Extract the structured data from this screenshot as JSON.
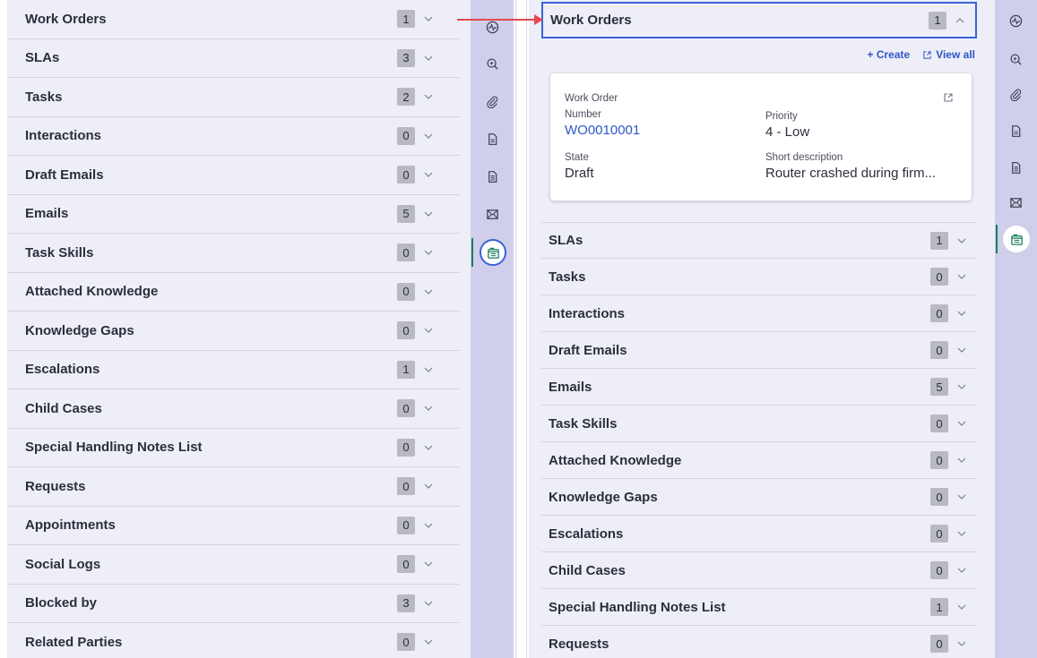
{
  "left_panel": {
    "items": [
      {
        "label": "Work Orders",
        "count": "1"
      },
      {
        "label": "SLAs",
        "count": "3"
      },
      {
        "label": "Tasks",
        "count": "2"
      },
      {
        "label": "Interactions",
        "count": "0"
      },
      {
        "label": "Draft Emails",
        "count": "0"
      },
      {
        "label": "Emails",
        "count": "5"
      },
      {
        "label": "Task Skills",
        "count": "0"
      },
      {
        "label": "Attached Knowledge",
        "count": "0"
      },
      {
        "label": "Knowledge Gaps",
        "count": "0"
      },
      {
        "label": "Escalations",
        "count": "1"
      },
      {
        "label": "Child Cases",
        "count": "0"
      },
      {
        "label": "Special Handling Notes List",
        "count": "0"
      },
      {
        "label": "Requests",
        "count": "0"
      },
      {
        "label": "Appointments",
        "count": "0"
      },
      {
        "label": "Social Logs",
        "count": "0"
      },
      {
        "label": "Blocked by",
        "count": "3"
      },
      {
        "label": "Related Parties",
        "count": "0"
      }
    ]
  },
  "right_panel": {
    "expanded": {
      "label": "Work Orders",
      "count": "1"
    },
    "actions": {
      "create": "+ Create",
      "view_all": "View all"
    },
    "card": {
      "title": "Work Order",
      "number_label": "Number",
      "number_value": "WO0010001",
      "priority_label": "Priority",
      "priority_value": "4 - Low",
      "state_label": "State",
      "state_value": "Draft",
      "desc_label": "Short description",
      "desc_value": "Router crashed during firm..."
    },
    "items": [
      {
        "label": "SLAs",
        "count": "1"
      },
      {
        "label": "Tasks",
        "count": "0"
      },
      {
        "label": "Interactions",
        "count": "0"
      },
      {
        "label": "Draft Emails",
        "count": "0"
      },
      {
        "label": "Emails",
        "count": "5"
      },
      {
        "label": "Task Skills",
        "count": "0"
      },
      {
        "label": "Attached Knowledge",
        "count": "0"
      },
      {
        "label": "Knowledge Gaps",
        "count": "0"
      },
      {
        "label": "Escalations",
        "count": "0"
      },
      {
        "label": "Child Cases",
        "count": "0"
      },
      {
        "label": "Special Handling Notes List",
        "count": "1"
      },
      {
        "label": "Requests",
        "count": "0"
      }
    ]
  },
  "rail_icons": [
    "activity-icon",
    "search-knowledge-icon",
    "attachment-icon",
    "document-icon",
    "document-lines-icon",
    "email-icon",
    "records-icon"
  ],
  "colors": {
    "accent": "#3b63d6",
    "arrow": "#e5484d",
    "active": "#1c7e5e",
    "link": "#2f56c6"
  }
}
